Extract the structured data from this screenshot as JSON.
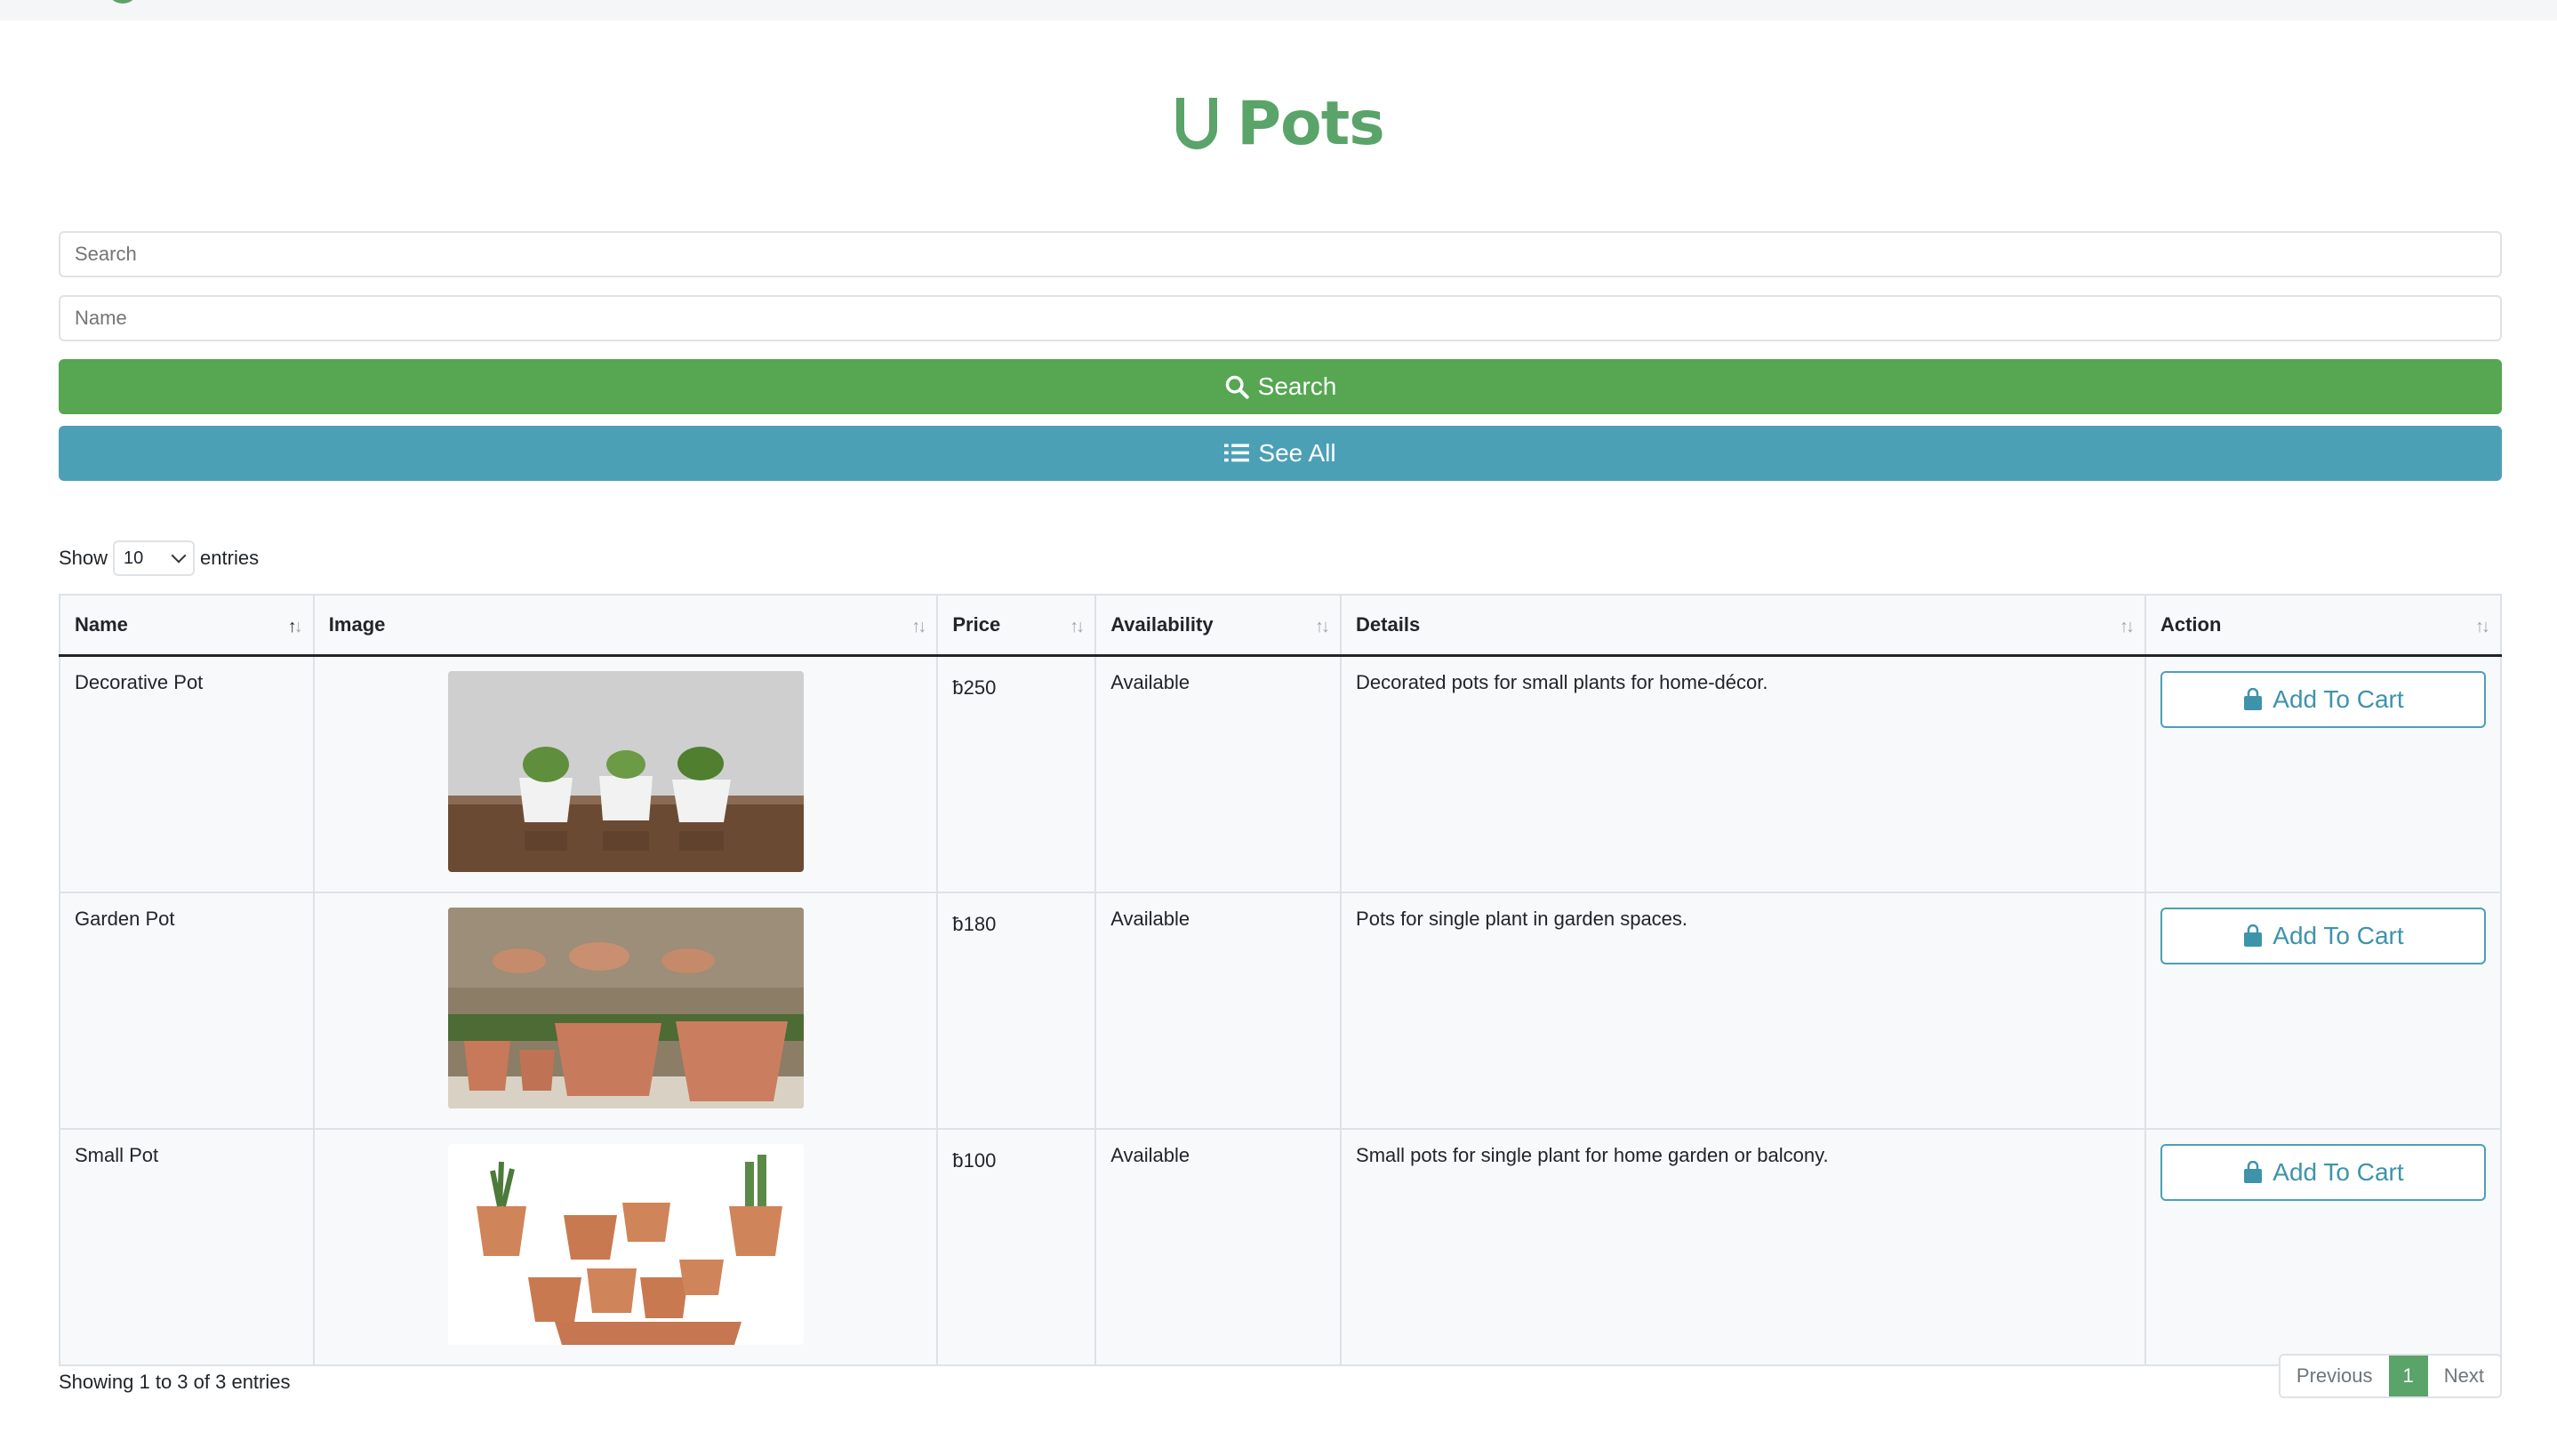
{
  "page": {
    "title": "Pots"
  },
  "search": {
    "search_placeholder": "Search",
    "name_placeholder": "Name",
    "search_button": "Search",
    "see_all_button": "See All"
  },
  "table_length": {
    "show": "Show",
    "value": "10",
    "entries": "entries"
  },
  "table": {
    "headers": [
      "Name",
      "Image",
      "Price",
      "Availability",
      "Details",
      "Action"
    ],
    "rows": [
      {
        "name": "Decorative Pot",
        "image": "decorative-pot-photo",
        "price": "ƀ250",
        "availability": "Available",
        "details": "Decorated pots for small plants for home-décor.",
        "action": "Add To Cart"
      },
      {
        "name": "Garden Pot",
        "image": "garden-pot-photo",
        "price": "ƀ180",
        "availability": "Available",
        "details": "Pots for single plant in garden spaces.",
        "action": "Add To Cart"
      },
      {
        "name": "Small Pot",
        "image": "small-pot-photo",
        "price": "ƀ100",
        "availability": "Available",
        "details": "Small pots for single plant for home garden or balcony.",
        "action": "Add To Cart"
      }
    ]
  },
  "footer": {
    "info": "Showing 1 to 3 of 3 entries",
    "previous": "Previous",
    "current_page": "1",
    "next": "Next"
  },
  "colors": {
    "brand_green": "#5aa469",
    "search_button": "#56a652",
    "see_all_button": "#4ba0b6"
  },
  "icons": [
    "search-icon",
    "list-icon",
    "bag-icon",
    "sort-icon"
  ]
}
